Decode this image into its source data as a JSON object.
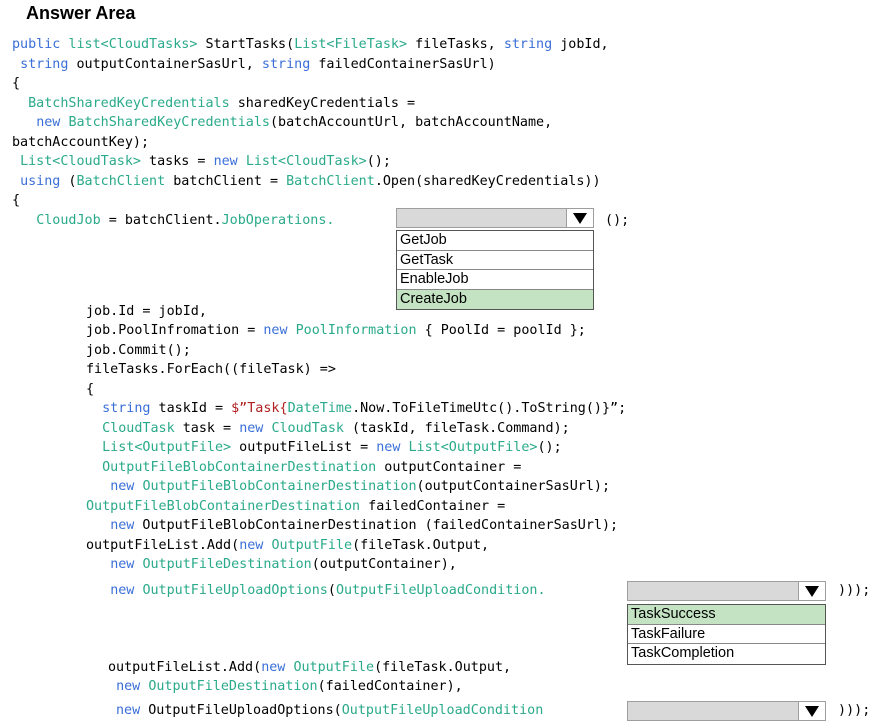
{
  "title": "Answer Area",
  "code": {
    "l1a": "public ",
    "l1b": "list<CloudTasks>",
    "l1c": " StartTasks(",
    "l1d": "List<FileTask>",
    "l1e": " fileTasks, ",
    "l1f": "string",
    "l1g": " jobId,",
    "l2a": " ",
    "l2b": "string",
    "l2c": " outputContainerSasUrl, ",
    "l2d": "string",
    "l2e": " failedContainerSasUrl)",
    "l3": "{",
    "l4a": "  ",
    "l4b": "BatchSharedKeyCredentials",
    "l4c": " sharedKeyCredentials =",
    "l5a": "   ",
    "l5b": "new",
    "l5c": " ",
    "l5d": "BatchSharedKeyCredentials",
    "l5e": "(batchAccountUrl, batchAccountName,",
    "l6": "batchAccountKey);",
    "l7a": " ",
    "l7b": "List<CloudTask>",
    "l7c": " tasks = ",
    "l7d": "new",
    "l7e": " ",
    "l7f": "List<CloudTask>",
    "l7g": "();",
    "l8a": " ",
    "l8b": "using",
    "l8c": " (",
    "l8d": "BatchClient",
    "l8e": " batchClient = ",
    "l8f": "BatchClient",
    "l8g": ".Open(sharedKeyCredentials))",
    "l9": "{",
    "l10a": "   ",
    "l10b": "CloudJob",
    "l10c": " = batchClient.",
    "l10d": "JobOperations.",
    "l10e": " ();",
    "l11": "job.Id = jobId,",
    "l12a": "job.PoolInfromation = ",
    "l12b": "new",
    "l12c": " ",
    "l12d": "PoolInformation",
    "l12e": " { PoolId = poolId };",
    "l13": "job.Commit();",
    "l14": "fileTasks.ForEach((fileTask) =>",
    "l15": "{",
    "l16a": "  ",
    "l16b": "string",
    "l16c": " taskId = ",
    "l16d": "$”Task{",
    "l16e": "DateTime",
    "l16f": ".Now.ToFileTimeUtc().ToString()}”;",
    "l17a": "  ",
    "l17b": "CloudTask",
    "l17c": " task = ",
    "l17d": "new",
    "l17e": " ",
    "l17f": "CloudTask",
    "l17g": " (taskId, fileTask.Command);",
    "l18a": "  ",
    "l18b": "List<OutputFile>",
    "l18c": " outputFileList = ",
    "l18d": "new",
    "l18e": " ",
    "l18f": "List<OutputFile>",
    "l18g": "();",
    "l19a": "  ",
    "l19b": "OutputFileBlobContainerDestination",
    "l19c": " outputContainer =",
    "l20a": "   ",
    "l20b": "new",
    "l20c": " ",
    "l20d": "OutputFileBlobContainerDestination",
    "l20e": "(outputContainerSasUrl);",
    "l21a": "OutputFileBlobContainerDestination",
    "l21b": " failedContainer =",
    "l22a": "   ",
    "l22b": "new",
    "l22c": " OutputFileBlobContainerDestination (failedContainerSasUrl);",
    "l23a": "outputFileList.Add(",
    "l23b": "new",
    "l23c": " ",
    "l23d": "OutputFile",
    "l23e": "(fileTask.Output,",
    "l24a": "   ",
    "l24b": "new",
    "l24c": " ",
    "l24d": "OutputFileDestination",
    "l24e": "(outputContainer),",
    "l25a": "   ",
    "l25b": "new",
    "l25c": " ",
    "l25d": "OutputFileUploadOptions",
    "l25e": "(",
    "l25f": "OutputFileUploadCondition.",
    "l25g": " )));",
    "l26a": "outputFileList.Add(",
    "l26b": "new",
    "l26c": " ",
    "l26d": "OutputFile",
    "l26e": "(fileTask.Output,",
    "l27a": " ",
    "l27b": "new",
    "l27c": " ",
    "l27d": "OutputFileDestination",
    "l27e": "(failedContainer),",
    "l28a": "new",
    "l28b": " OutputFileUploadOptions(",
    "l28c": "OutputFileUploadCondition",
    "l28d": " )));"
  },
  "dropdown1": {
    "options": [
      "GetJob",
      "GetTask",
      "EnableJob",
      "CreateJob"
    ],
    "selected": "CreateJob"
  },
  "dropdown2": {
    "options": [
      "TaskSuccess",
      "TaskFailure",
      "TaskCompletion"
    ],
    "selected": "TaskSuccess"
  },
  "colors": {
    "keyword": "#3a6fd8",
    "type": "#2aaa8a",
    "string": "#b02020",
    "selected_option": "#c3e3c3"
  },
  "icons": {
    "dropdown_arrow": "triangle-down-icon"
  }
}
